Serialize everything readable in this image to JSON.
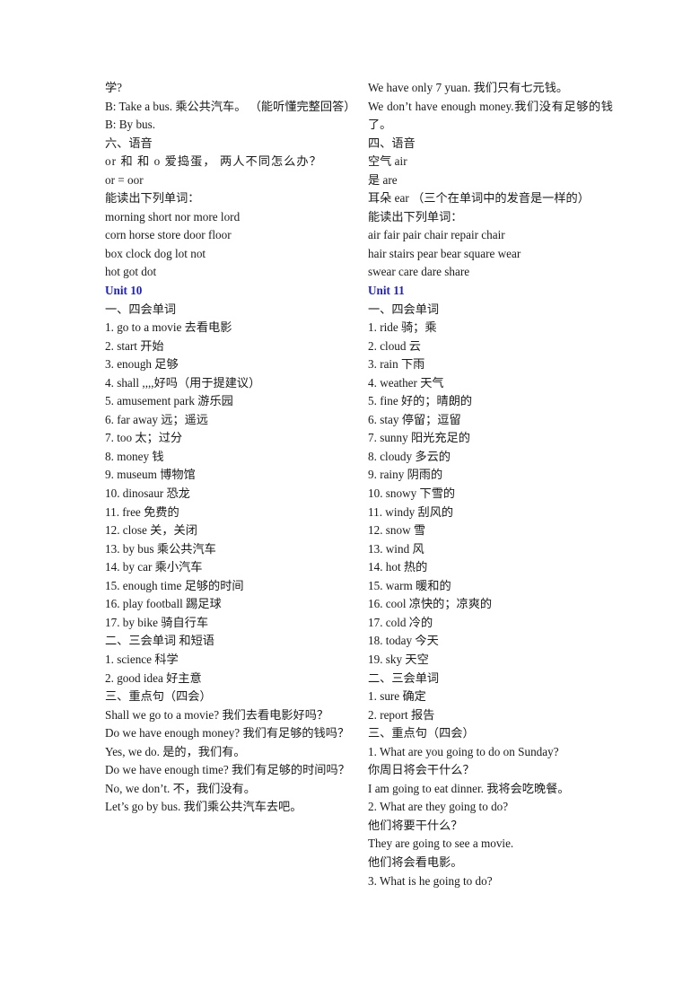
{
  "document": {
    "title": "Unit 10 / Unit 11 英语复习资料",
    "heading_color": "#2020c0",
    "text_color": "#1a1a1a",
    "background_color": "#ffffff"
  },
  "left_column": {
    "lines": [
      "学?",
      "B: Take a bus. 乘公共汽车。 （能听懂完整回答）",
      "B: By bus.",
      "六、语音",
      "or 和 和 o  爱捣蛋， 两人不同怎么办？",
      "or = oor",
      "能读出下列单词：",
      "morning short nor more lord",
      "corn horse store door floor",
      "box clock dog lot not",
      "hot got dot"
    ],
    "unit_heading": "Unit 10",
    "section_one_title": "一、四会单词",
    "four_skill_words": [
      "1. go to a movie  去看电影",
      "2. start  开始",
      "3. enough  足够",
      "4. shall  ,,,,好吗（用于提建议）",
      "5. amusement park  游乐园",
      "6. far away  远；遥远",
      "7. too  太；过分",
      "8. money  钱",
      "9. museum  博物馆",
      "10. dinosaur  恐龙",
      "11. free  免费的",
      "12. close  关，关闭",
      "13. by bus  乘公共汽车",
      "14. by car  乘小汽车",
      "15. enough time  足够的时间",
      "16. play football  踢足球",
      "17. by bike  骑自行车"
    ],
    "section_two_title": "二、三会单词 和短语",
    "three_skill_words": [
      "1. science  科学",
      "2. good idea  好主意"
    ],
    "section_three_title": "三、重点句（四会）",
    "key_sentences": [
      "Shall we go to a movie?  我们去看电影好吗？",
      "Do we have enough money?  我们有足够的钱吗？",
      "Yes, we do. 是的，我们有。",
      "Do we have enough time?  我们有足够的时间吗？",
      "No, we don’t. 不，我们没有。",
      "Let’s go by bus. 我们乘公共汽车去吧。"
    ]
  },
  "right_column": {
    "continued_sentences": [
      "We have only 7 yuan. 我们只有七元钱。",
      "We don’t have enough money.我们没有足够的钱了。"
    ],
    "section_four_title": "四、语音",
    "phonics_pairs": [
      "空气  air",
      "是  are",
      "耳朵  ear  （三个在单词中的发音是一样的）"
    ],
    "phonics_prompt": "能读出下列单词：",
    "phonics_words": [
      "air fair pair chair repair chair",
      "hair stairs pear bear square wear",
      "swear care dare share"
    ],
    "unit_heading": "Unit 11",
    "section_one_title": "一、四会单词",
    "four_skill_words": [
      "1. ride  骑；乘",
      "2. cloud  云",
      "3. rain  下雨",
      "4. weather  天气",
      "5. fine  好的；晴朗的",
      "6. stay  停留；逗留",
      "7. sunny  阳光充足的",
      "8. cloudy  多云的",
      "9. rainy  阴雨的",
      "10. snowy  下雪的",
      "11. windy  刮风的",
      "12. snow  雪",
      "13. wind  风",
      "14. hot  热的",
      "15. warm  暖和的",
      "16. cool  凉快的；凉爽的",
      "17. cold  冷的",
      "18. today  今天",
      "19. sky  天空"
    ],
    "section_two_title": "二、三会单词",
    "three_skill_words": [
      "1. sure  确定",
      "2. report  报告"
    ],
    "section_three_title": "三、重点句（四会）",
    "key_sentences": [
      "1. What are you going to do on Sunday?",
      "你周日将会干什么？",
      "I am going to eat dinner. 我将会吃晚餐。",
      "2. What are they going to do?",
      "他们将要干什么？",
      "They are going to see a movie.",
      "他们将会看电影。",
      "3. What is he going to do?"
    ]
  }
}
